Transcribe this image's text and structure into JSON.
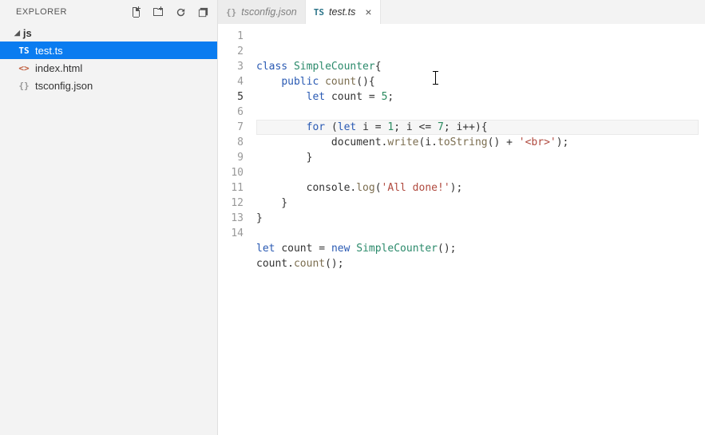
{
  "explorer": {
    "title": "EXPLORER",
    "folder": "js",
    "files": [
      {
        "icon": "TS",
        "name": "test.ts",
        "selected": true,
        "iconColorClass": "ts"
      },
      {
        "icon": "<>",
        "name": "index.html",
        "selected": false,
        "iconColorClass": "html"
      },
      {
        "icon": "{}",
        "name": "tsconfig.json",
        "selected": false,
        "iconColorClass": "json"
      }
    ]
  },
  "tabs": [
    {
      "icon": "{}",
      "label": "tsconfig.json",
      "active": false,
      "close": false,
      "iconClass": "json"
    },
    {
      "icon": "TS",
      "label": "test.ts",
      "active": true,
      "close": true,
      "iconClass": "ts"
    }
  ],
  "closeGlyph": "×",
  "code": {
    "currentLine": 5,
    "lines": [
      [
        {
          "t": "class ",
          "c": "tok-kw"
        },
        {
          "t": "SimpleCounter",
          "c": "tok-type"
        },
        {
          "t": "{"
        }
      ],
      [
        {
          "t": "    "
        },
        {
          "t": "public ",
          "c": "tok-kw"
        },
        {
          "t": "count",
          "c": "tok-fn"
        },
        {
          "t": "(){"
        }
      ],
      [
        {
          "t": "        "
        },
        {
          "t": "let ",
          "c": "tok-kw"
        },
        {
          "t": "count = "
        },
        {
          "t": "5",
          "c": "tok-num"
        },
        {
          "t": ";"
        }
      ],
      [],
      [
        {
          "t": "        "
        },
        {
          "t": "for ",
          "c": "tok-kw"
        },
        {
          "t": "("
        },
        {
          "t": "let ",
          "c": "tok-kw"
        },
        {
          "t": "i = "
        },
        {
          "t": "1",
          "c": "tok-num"
        },
        {
          "t": "; i <= "
        },
        {
          "t": "7",
          "c": "tok-num"
        },
        {
          "t": "; i++){"
        }
      ],
      [
        {
          "t": "            document."
        },
        {
          "t": "write",
          "c": "tok-fn"
        },
        {
          "t": "(i."
        },
        {
          "t": "toString",
          "c": "tok-fn"
        },
        {
          "t": "() + "
        },
        {
          "t": "'<br>'",
          "c": "tok-str"
        },
        {
          "t": ");"
        }
      ],
      [
        {
          "t": "        }"
        }
      ],
      [],
      [
        {
          "t": "        console."
        },
        {
          "t": "log",
          "c": "tok-fn"
        },
        {
          "t": "("
        },
        {
          "t": "'All done!'",
          "c": "tok-str"
        },
        {
          "t": ");"
        }
      ],
      [
        {
          "t": "    }"
        }
      ],
      [
        {
          "t": "}"
        }
      ],
      [],
      [
        {
          "t": "let ",
          "c": "tok-kw"
        },
        {
          "t": "count = "
        },
        {
          "t": "new ",
          "c": "tok-kw"
        },
        {
          "t": "SimpleCounter",
          "c": "tok-type"
        },
        {
          "t": "();"
        }
      ],
      [
        {
          "t": "count."
        },
        {
          "t": "count",
          "c": "tok-fn"
        },
        {
          "t": "();"
        }
      ]
    ]
  }
}
